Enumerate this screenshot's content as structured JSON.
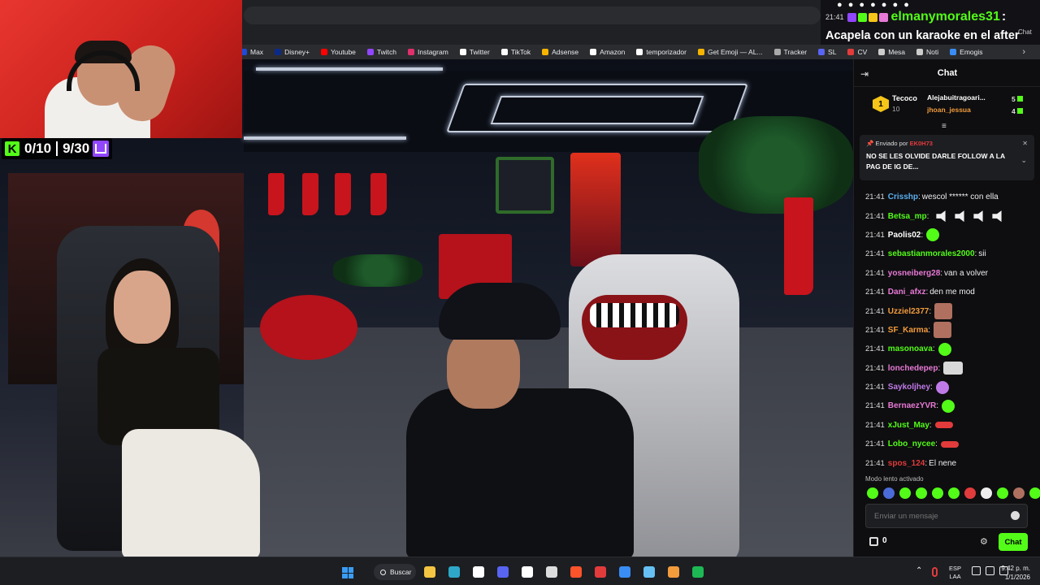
{
  "bookmarks": [
    {
      "label": "Max",
      "color": "#1d4bd8"
    },
    {
      "label": "Disney+",
      "color": "#0a2a8a"
    },
    {
      "label": "Youtube",
      "color": "#ff0000"
    },
    {
      "label": "Twitch",
      "color": "#9146ff"
    },
    {
      "label": "Instagram",
      "color": "#e1306c"
    },
    {
      "label": "Twitter",
      "color": "#ffffff"
    },
    {
      "label": "TikTok",
      "color": "#ffffff"
    },
    {
      "label": "Adsense",
      "color": "#f4b400"
    },
    {
      "label": "Amazon",
      "color": "#ffffff"
    },
    {
      "label": "temporizador",
      "color": "#ffffff"
    },
    {
      "label": "Get Emoji — AL...",
      "color": "#f4b400"
    },
    {
      "label": "Tracker",
      "color": "#aaaaaa"
    },
    {
      "label": "SL",
      "color": "#5865f2"
    },
    {
      "label": "CV",
      "color": "#e23b3b"
    },
    {
      "label": "Mesa",
      "color": "#cccccc"
    },
    {
      "label": "Noti",
      "color": "#cccccc"
    },
    {
      "label": "Emogis",
      "color": "#3a8df5"
    }
  ],
  "counter": {
    "kick_value": "0/10",
    "twitch_value": "9/30",
    "kick_color": "#53fc18",
    "twitch_color": "#9146ff"
  },
  "notification": {
    "dots": "● ● ● ● ● ● ●",
    "time": "21:41",
    "username": "elmanymorales31",
    "colon": ":",
    "message": "Acapela con un karaoke en el after",
    "chat_button": "Chat"
  },
  "chat": {
    "title": "Chat",
    "leaderboard": {
      "top": {
        "rank": "1",
        "name": "Tecoco",
        "value": "10"
      },
      "rows": [
        {
          "name": "Alejabuitragoari...",
          "value": "5",
          "color": "#ffffff"
        },
        {
          "name": "jhoan_jessua",
          "value": "4",
          "color": "#f39c3c"
        }
      ]
    },
    "pinned": {
      "sent_by": "Enviado por",
      "sender": "EK0H73",
      "message": "NO SE LES OLVIDE DARLE FOLLOW A LA PAG DE IG DE..."
    },
    "messages": [
      {
        "time": "21:41",
        "user": "Crisshp",
        "color": "#5ab0f0",
        "text": "wescol ****** con ella",
        "emote": ""
      },
      {
        "time": "21:41",
        "user": "Betsa_mp",
        "color": "#53fc18",
        "text": "",
        "emote": "speakers"
      },
      {
        "time": "21:41",
        "user": "Paolis02",
        "color": "#ffffff",
        "text": "",
        "emote": "green"
      },
      {
        "time": "21:41",
        "user": "sebastianmorales2000",
        "color": "#53fc18",
        "text": "sii",
        "emote": ""
      },
      {
        "time": "21:41",
        "user": "yosneiberg28",
        "color": "#e879d6",
        "text": "van a volver",
        "emote": ""
      },
      {
        "time": "21:41",
        "user": "Dani_afxz",
        "color": "#e879d6",
        "text": "den me mod",
        "emote": ""
      },
      {
        "time": "21:41",
        "user": "Uzziel2377",
        "color": "#f39c3c",
        "text": "",
        "emote": "face"
      },
      {
        "time": "21:41",
        "user": "SF_Karma",
        "color": "#f39c3c",
        "text": "",
        "emote": "face"
      },
      {
        "time": "21:41",
        "user": "masonoava",
        "color": "#53fc18",
        "text": "",
        "emote": "green"
      },
      {
        "time": "21:41",
        "user": "lonchedepep",
        "color": "#e879d6",
        "text": "",
        "emote": "gray"
      },
      {
        "time": "21:41",
        "user": "Saykoljhey",
        "color": "#c07ae8",
        "text": "",
        "emote": "purple"
      },
      {
        "time": "21:41",
        "user": "BernaezYVR",
        "color": "#e879d6",
        "text": "",
        "emote": "green"
      },
      {
        "time": "21:41",
        "user": "xJust_May",
        "color": "#53fc18",
        "text": "",
        "emote": "car"
      },
      {
        "time": "21:41",
        "user": "Lobo_nycee",
        "color": "#53fc18",
        "text": "",
        "emote": "car"
      },
      {
        "time": "21:41",
        "user": "spos_124",
        "color": "#e23b3b",
        "text": "El nene",
        "emote": ""
      }
    ],
    "slow_mode": "Modo lento activado",
    "input_placeholder": "Enviar un mensaje",
    "points_count": "0",
    "send_label": "Chat",
    "accent": "#53fc18"
  },
  "taskbar": {
    "search_label": "Buscar",
    "apps": [
      {
        "name": "file-explorer-icon",
        "color": "#f4c542"
      },
      {
        "name": "edge-icon",
        "color": "#2ea8c9"
      },
      {
        "name": "capcut-icon",
        "color": "#ffffff"
      },
      {
        "name": "discord-icon",
        "color": "#5865f2"
      },
      {
        "name": "github-icon",
        "color": "#ffffff"
      },
      {
        "name": "epic-games-icon",
        "color": "#dddddd"
      },
      {
        "name": "brave-icon",
        "color": "#fb542b"
      },
      {
        "name": "app-red-icon",
        "color": "#e23b3b"
      },
      {
        "name": "app-blue-icon",
        "color": "#3a8df5"
      },
      {
        "name": "steam-icon",
        "color": "#66c0f4"
      },
      {
        "name": "app-orange-icon",
        "color": "#f39c3c"
      },
      {
        "name": "spotify-icon",
        "color": "#1db954"
      }
    ],
    "lang_1": "ESP",
    "lang_2": "LAA",
    "time": "9:42 p. m.",
    "date": "1/1/2026"
  }
}
